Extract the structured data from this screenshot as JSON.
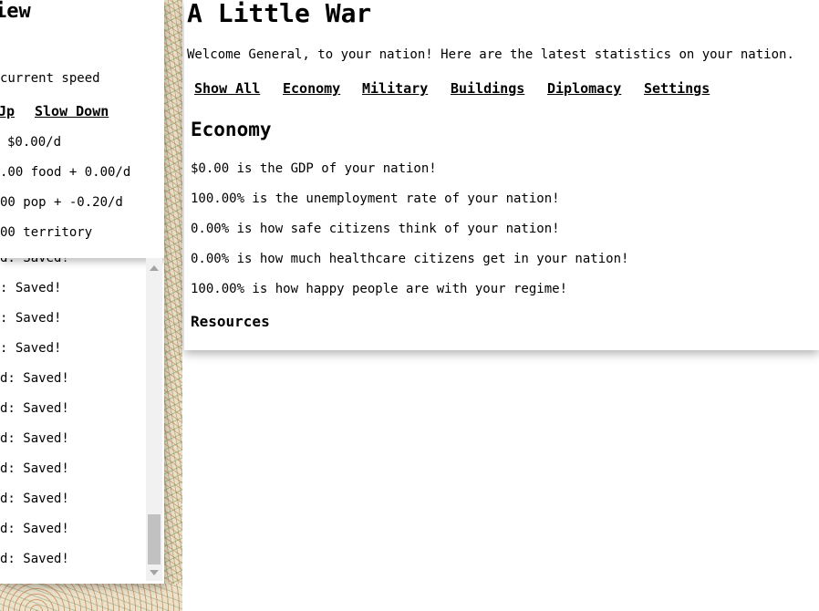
{
  "overview": {
    "title": "iew",
    "speed_label": " current speed",
    "speed_up": "Jp",
    "slow_down": "Slow Down",
    "money_rate": "$0.00/d",
    "food_rate": ".00 food + 0.00/d",
    "pop_rate": "00 pop + -0.20/d",
    "territory": "00 territory"
  },
  "log": {
    "entries": [
      "d: Saved!",
      ": Saved!",
      ": Saved!",
      ": Saved!",
      "d: Saved!",
      "d: Saved!",
      "d: Saved!",
      "d: Saved!",
      "d: Saved!",
      "d: Saved!",
      "d: Saved!"
    ]
  },
  "main": {
    "title": "A Little War",
    "welcome": "Welcome General, to your nation! Here are the latest statistics on your nation.",
    "nav": [
      "Show All",
      "Economy",
      "Military",
      "Buildings",
      "Diplomacy",
      "Settings"
    ],
    "section_title": "Economy",
    "stats": [
      "$0.00 is the GDP of your nation!",
      "100.00% is the unemployment rate of your nation!",
      "0.00% is how safe citizens think of your nation!",
      "0.00% is how much healthcare citizens get in your nation!",
      "100.00% is how happy people are with your regime!"
    ],
    "resources_title": "Resources"
  }
}
